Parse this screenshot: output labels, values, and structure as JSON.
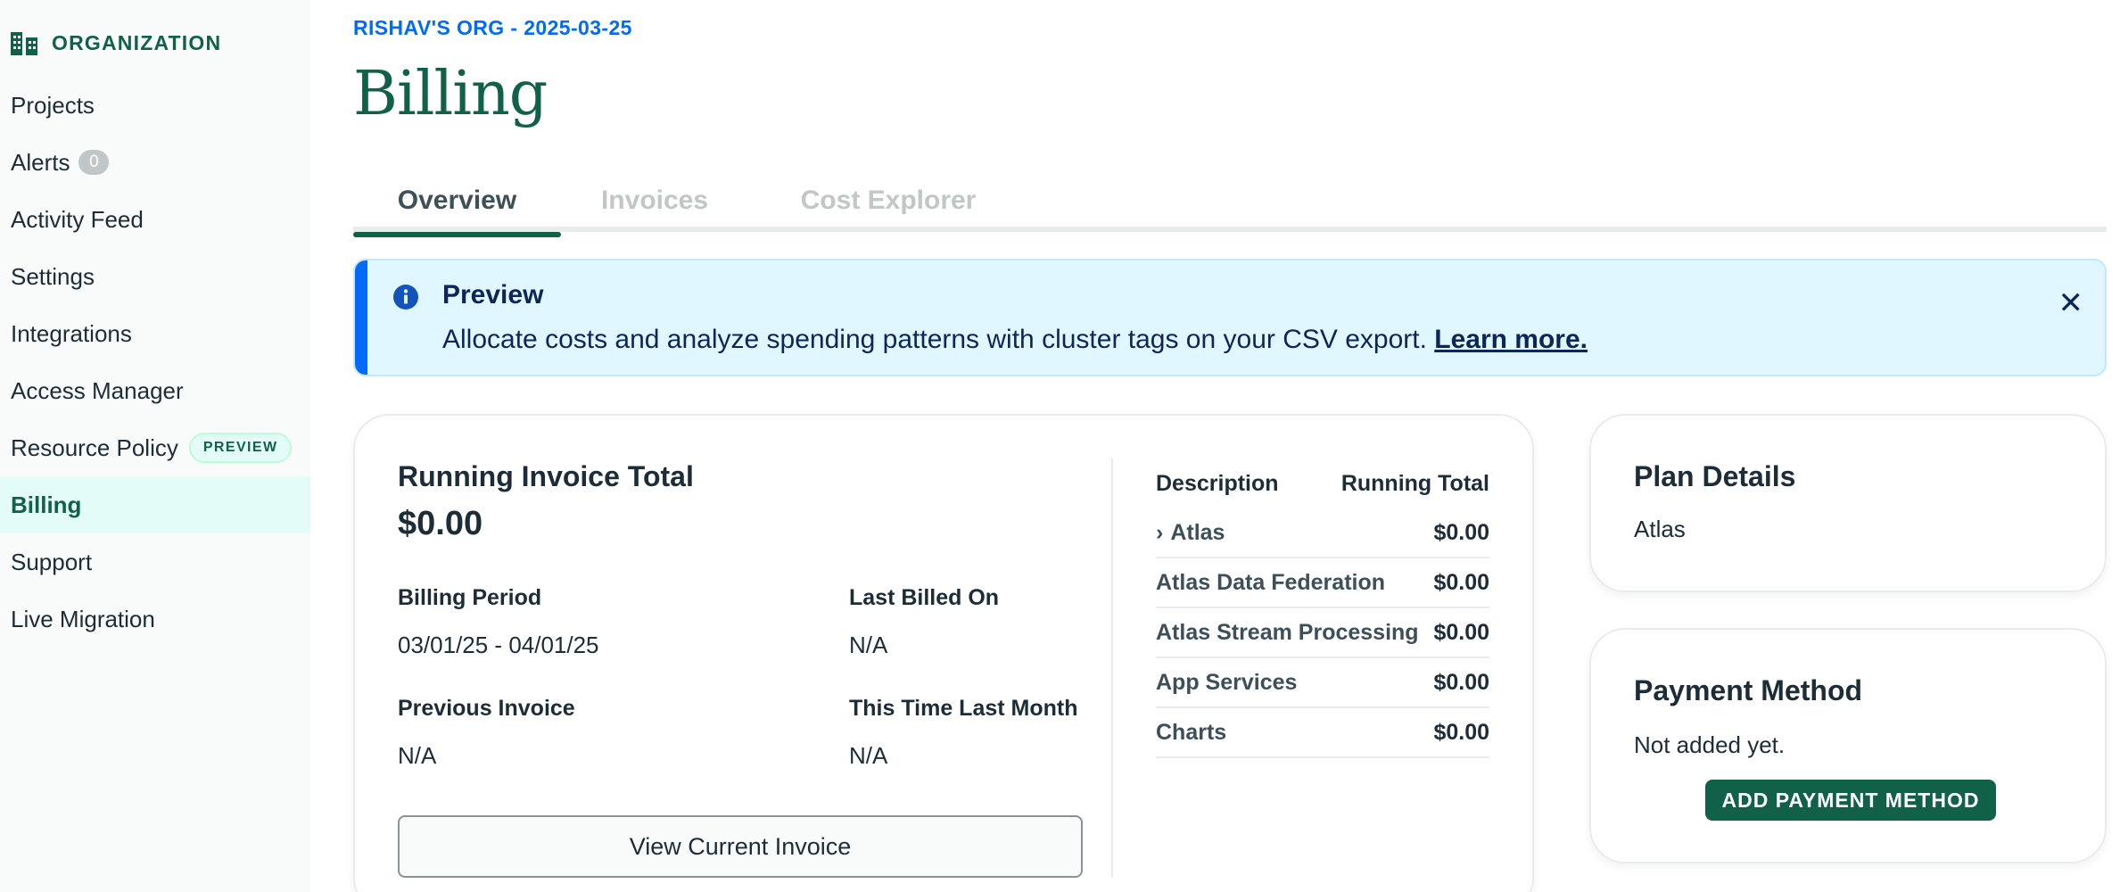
{
  "sidebar": {
    "org_title": "ORGANIZATION",
    "items": [
      {
        "label": "Projects"
      },
      {
        "label": "Alerts",
        "badge": "0"
      },
      {
        "label": "Activity Feed"
      },
      {
        "label": "Settings"
      },
      {
        "label": "Integrations"
      },
      {
        "label": "Access Manager"
      },
      {
        "label": "Resource Policy",
        "badge": "PREVIEW"
      },
      {
        "label": "Billing",
        "active": true
      },
      {
        "label": "Support"
      },
      {
        "label": "Live Migration"
      }
    ]
  },
  "header": {
    "breadcrumb": "RISHAV'S ORG - 2025-03-25",
    "title": "Billing"
  },
  "tabs": [
    {
      "label": "Overview",
      "active": true
    },
    {
      "label": "Invoices"
    },
    {
      "label": "Cost Explorer"
    }
  ],
  "banner": {
    "title": "Preview",
    "text": "Allocate costs and analyze spending patterns with cluster tags on your CSV export.",
    "link": "Learn more.",
    "close": "✕",
    "icon": "info-icon"
  },
  "invoice": {
    "title": "Running Invoice Total",
    "total": "$0.00",
    "billing_period_label": "Billing Period",
    "billing_period_value": "03/01/25 - 04/01/25",
    "last_billed_label": "Last Billed On",
    "last_billed_value": "N/A",
    "previous_invoice_label": "Previous Invoice",
    "previous_invoice_value": "N/A",
    "this_time_label": "This Time Last Month",
    "this_time_value": "N/A",
    "view_button": "View Current Invoice",
    "table": {
      "col_description": "Description",
      "col_total": "Running Total",
      "rows": [
        {
          "description": "Atlas",
          "total": "$0.00",
          "expandable": true
        },
        {
          "description": "Atlas Data Federation",
          "total": "$0.00"
        },
        {
          "description": "Atlas Stream Processing",
          "total": "$0.00"
        },
        {
          "description": "App Services",
          "total": "$0.00"
        },
        {
          "description": "Charts",
          "total": "$0.00"
        }
      ]
    }
  },
  "plan": {
    "title": "Plan Details",
    "value": "Atlas"
  },
  "payment": {
    "title": "Payment Method",
    "value": "Not added yet.",
    "button": "ADD PAYMENT METHOD"
  },
  "colors": {
    "brand_green": "#116149",
    "link_blue": "#016bf8",
    "banner_bg": "#e1f7ff"
  }
}
